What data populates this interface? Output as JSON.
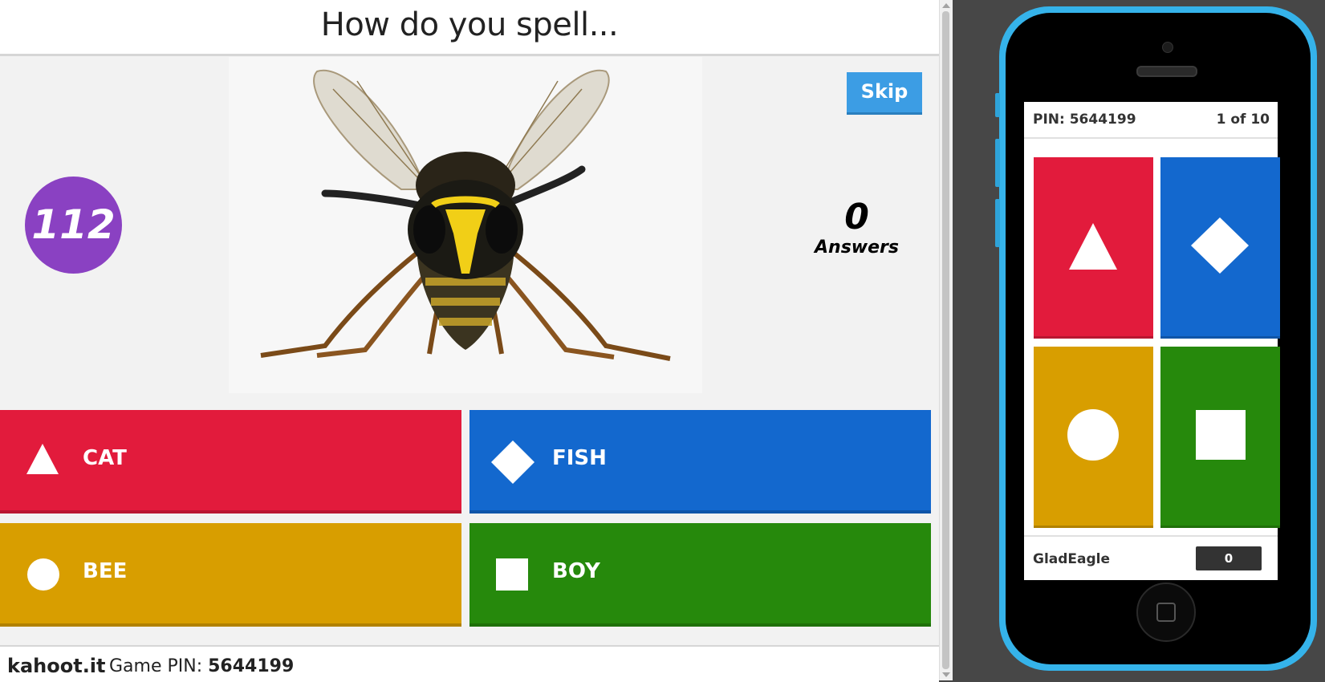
{
  "question": {
    "title": "How do you spell..."
  },
  "timer": {
    "value": "112"
  },
  "skip": {
    "label": "Skip"
  },
  "answers_counter": {
    "count": "0",
    "label": "Answers"
  },
  "answers": [
    {
      "shape": "triangle-icon",
      "label": "CAT",
      "color": "#e21b3c"
    },
    {
      "shape": "diamond-icon",
      "label": "FISH",
      "color": "#1368ce"
    },
    {
      "shape": "circle-icon",
      "label": "BEE",
      "color": "#d89e00"
    },
    {
      "shape": "square-icon",
      "label": "BOY",
      "color": "#26890c"
    }
  ],
  "footer": {
    "site": "kahoot.it",
    "pin_label": "Game PIN: ",
    "pin_value": "5644199"
  },
  "phone": {
    "pin": "PIN: 5644199",
    "progress": "1 of 10",
    "player_name": "GladEagle",
    "score": "0"
  },
  "colors": {
    "timer": "#8a41c2",
    "skip": "#3c9de4",
    "phone_frame": "#35b3ea"
  }
}
